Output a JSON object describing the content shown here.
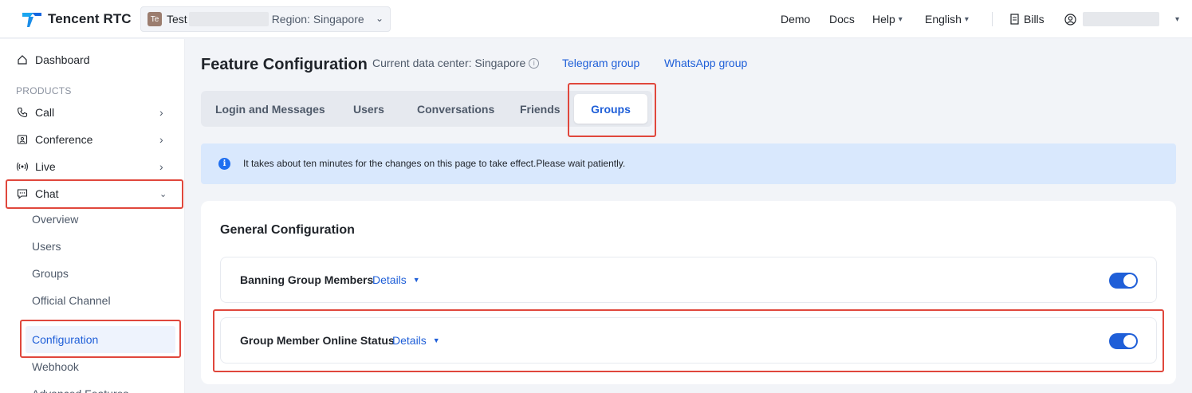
{
  "topbar": {
    "brand": "Tencent RTC",
    "app_avatar": "Te",
    "app_name": "Test",
    "region": "Region: Singapore",
    "nav": {
      "demo": "Demo",
      "docs": "Docs",
      "help": "Help",
      "language": "English",
      "bills": "Bills"
    }
  },
  "sidebar": {
    "dashboard": "Dashboard",
    "section_products": "PRODUCTS",
    "products": [
      {
        "label": "Call",
        "icon": "phone-icon"
      },
      {
        "label": "Conference",
        "icon": "conference-icon"
      },
      {
        "label": "Live",
        "icon": "broadcast-icon"
      },
      {
        "label": "Chat",
        "icon": "chat-icon"
      }
    ],
    "chat_sub": [
      "Overview",
      "Users",
      "Groups",
      "Official Channel",
      "Configuration",
      "Webhook",
      "Advanced Features"
    ],
    "active_sub": "Configuration"
  },
  "main": {
    "title": "Feature Configuration",
    "data_center": "Current data center: Singapore",
    "links": {
      "telegram": "Telegram group",
      "whatsapp": "WhatsApp group"
    },
    "tabs": [
      "Login and Messages",
      "Users",
      "Conversations",
      "Friends",
      "Groups"
    ],
    "active_tab": "Groups",
    "notice": "It takes about ten minutes for the changes on this page to take effect.Please wait patiently.",
    "section_title": "General Configuration",
    "rows": [
      {
        "name": "Banning Group Members",
        "details": "Details",
        "enabled": true
      },
      {
        "name": "Group Member Online Status",
        "details": "Details",
        "enabled": true
      }
    ]
  },
  "colors": {
    "accent": "#1f5fd8",
    "highlight": "#e0473c",
    "notice_bg": "#d9e8fd"
  }
}
